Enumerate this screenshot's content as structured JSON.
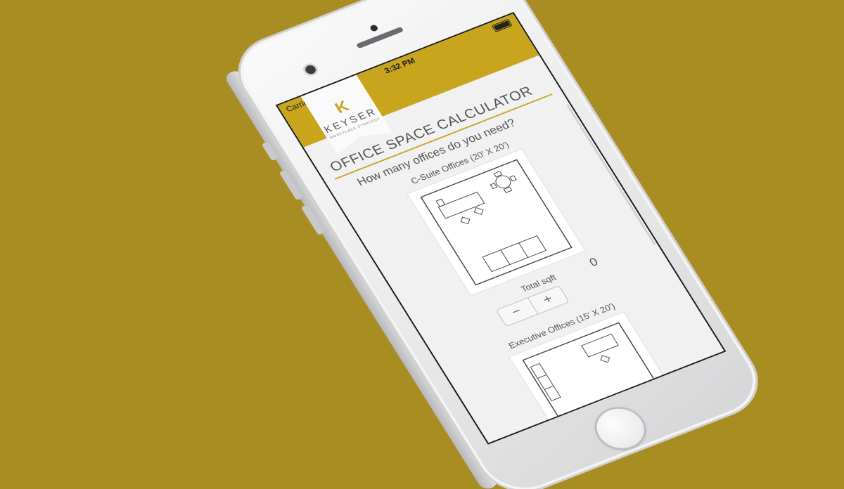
{
  "statusbar": {
    "carrier": "Carrier",
    "time": "3:32 PM"
  },
  "logo": {
    "name": "KEYSER",
    "mark": "K",
    "tagline": "WORKPLACE STRATEGY"
  },
  "calculator": {
    "title": "OFFICE SPACE CALCULATOR",
    "question": "How many offices do you need?",
    "offices": [
      {
        "label": "C-Suite Offices (20' X 20')"
      },
      {
        "label": "Executive Offices (15' X 20')"
      }
    ],
    "total_label": "Total sqft",
    "total_value": "0",
    "stepper": {
      "minus": "−",
      "plus": "+"
    }
  },
  "colors": {
    "background": "#a88e22",
    "accent": "#c9a51d"
  },
  "icons": [
    "wifi-icon",
    "battery-icon",
    "minus-icon",
    "plus-icon"
  ]
}
